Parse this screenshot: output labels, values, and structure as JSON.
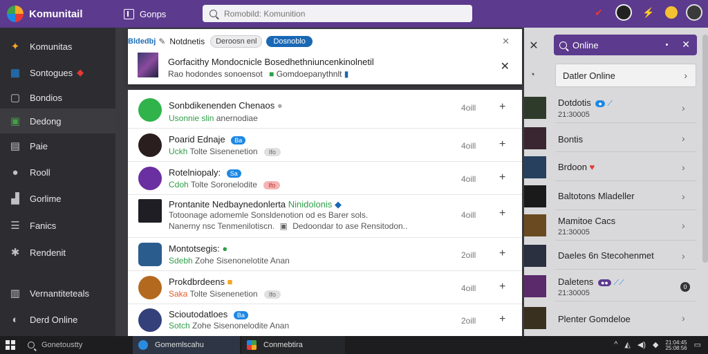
{
  "app": {
    "title": "Komunitail",
    "groups_label": "Gonps"
  },
  "search": {
    "placeholder": "Romobild: Komunition"
  },
  "sidebar": {
    "items": [
      {
        "label": "Komunitas",
        "icon": "community-icon"
      },
      {
        "label": "Sontogues",
        "icon": "groups-icon"
      },
      {
        "label": "Bondios",
        "icon": "square-icon"
      },
      {
        "label": "Dedong",
        "icon": "game-icon"
      },
      {
        "label": "Paie",
        "icon": "page-icon"
      },
      {
        "label": "Rooll",
        "icon": "chat-icon"
      },
      {
        "label": "Gorlime",
        "icon": "puzzle-icon"
      },
      {
        "label": "Fanics",
        "icon": "list-icon"
      },
      {
        "label": "Rendenit",
        "icon": "gear-icon"
      },
      {
        "label": "Vernantiteteals",
        "icon": "grid-icon"
      },
      {
        "label": "Derd Online",
        "icon": "globe-icon"
      }
    ]
  },
  "notification": {
    "tag": "Bldedbj",
    "title": "Notdnetis",
    "pill1": "Deroosn enl",
    "pill2": "Dosnoblo",
    "headline": "Gorfacithy Mondocnicle Bosedhethniuncenkinolnetil",
    "subline_prefix": "Rao hodondes sonoensot",
    "subline_green": "Gomdoepanythnlt"
  },
  "list": {
    "rows": [
      {
        "title": "Sonbdikenenden Chenaos",
        "sub_green": "Usonnie slin",
        "sub_rest": "anernodiae",
        "time": "4oill"
      },
      {
        "title": "Poarid Ednaje",
        "badge": "Ba",
        "sub_green": "Uckh",
        "sub_rest": "Tolte Sisenenetion",
        "chip": "Ifo",
        "time": "4oill"
      },
      {
        "title": "Rotelniopaly:",
        "badge": "Sa",
        "sub_green": "Cdoh",
        "sub_rest": "Tolte Soronelodite",
        "chip": "Ifo",
        "time": "4oill"
      },
      {
        "title": "Prontanite Nedbaynedonlerta",
        "title_green": "Ninidolonis",
        "desc1": "Totoonage adomemle Sonsldenotion od es Barer sols.",
        "desc2": "Nanerny nsc Tenmenilotiscn.",
        "desc2b": "Dedoondar to ase Rensitodon..",
        "time": "4oill"
      },
      {
        "title": "Montotsegis:",
        "sub_green": "Sdebh",
        "sub_rest": "Zohe Sisenonelotite Anan",
        "time": "2oill"
      },
      {
        "title": "Prokdbrdeens",
        "sub_orange": "Saka",
        "sub_rest": "Tolte Sisenenetion",
        "chip": "Ifo",
        "time": "4oill"
      },
      {
        "title": "Scioutodatloes",
        "badge": "Ba",
        "sub_green": "Sotch",
        "sub_rest": "Zohe Sisenonelodite Anan",
        "time": "2oill"
      }
    ]
  },
  "right_panel": {
    "search_label": "Online",
    "header": "Datler Online",
    "items": [
      {
        "name": "Dotdotis",
        "sub": "21:30005"
      },
      {
        "name": "Bontis"
      },
      {
        "name": "Brdoon"
      },
      {
        "name": "Baltotons Mladeller"
      },
      {
        "name": "Mamitoe Cacs",
        "sub": "21:30005"
      },
      {
        "name": "Daeles 6n Stecohenmet"
      },
      {
        "name": "Daletens",
        "sub": "21:30005",
        "count": "0"
      },
      {
        "name": "Plenter Gomdeloe"
      }
    ]
  },
  "taskbar": {
    "search": "Gonetoustty",
    "app1": "Gomemlscahu",
    "app2": "Conmebtira",
    "clock_time": "21:04:45",
    "clock_date": "25:08:56"
  },
  "colors": {
    "accent": "#5c3a8e",
    "green": "#2e9e48",
    "blue": "#1868b5"
  }
}
